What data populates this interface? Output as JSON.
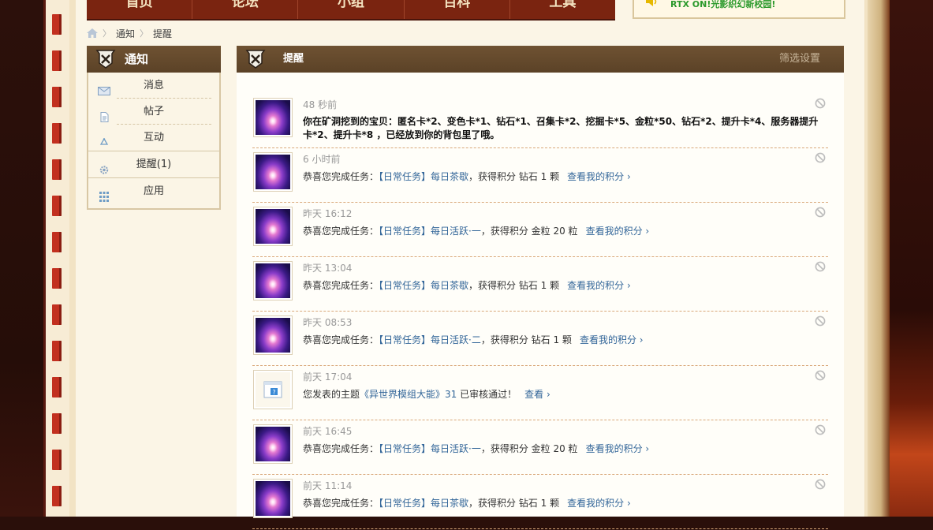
{
  "nav": {
    "items": [
      "首页",
      "论坛",
      "小组",
      "百科",
      "工具"
    ]
  },
  "announcement": {
    "text": "RTX ON!光影织幻新校园!",
    "icon": "speaker-icon"
  },
  "breadcrumb": {
    "home_icon": "home-icon",
    "items": [
      "通知",
      "提醒"
    ]
  },
  "sidebar": {
    "title": "通知",
    "items": [
      {
        "label": "消息",
        "icon": "mail-icon"
      },
      {
        "label": "帖子",
        "icon": "document-icon"
      },
      {
        "label": "互动",
        "icon": "recycle-icon"
      },
      {
        "label": "提醒(1)",
        "icon": "gear-icon"
      },
      {
        "label": "应用",
        "icon": "grid-icon"
      }
    ]
  },
  "main": {
    "title": "提醒",
    "filter_label": "筛选设置",
    "notices": [
      {
        "time": "48 秒前",
        "text": "你在矿洞挖到的宝贝：匿名卡*2、变色卡*1、钻石*1、召集卡*2、挖掘卡*5、金粒*50、钻石*2、提升卡*4、服务器提升卡*2、提升卡*8 ，已经放到你的背包里了哦。",
        "avatar": "galaxy"
      },
      {
        "time": "6 小时前",
        "prefix": "恭喜您完成任务：",
        "task": "【日常任务】每日茶歇",
        "reward": "，获得积分 钻石 1 颗",
        "link": "查看我的积分 ›",
        "avatar": "galaxy"
      },
      {
        "time": "昨天 16:12",
        "prefix": "恭喜您完成任务：",
        "task": "【日常任务】每日活跃·一",
        "reward": "，获得积分 金粒 20 粒",
        "link": "查看我的积分 ›",
        "avatar": "galaxy"
      },
      {
        "time": "昨天 13:04",
        "prefix": "恭喜您完成任务：",
        "task": "【日常任务】每日茶歇",
        "reward": "，获得积分 钻石 1 颗",
        "link": "查看我的积分 ›",
        "avatar": "galaxy"
      },
      {
        "time": "昨天 08:53",
        "prefix": "恭喜您完成任务：",
        "task": "【日常任务】每日活跃·二",
        "reward": "，获得积分 钻石 1 颗",
        "link": "查看我的积分 ›",
        "avatar": "galaxy"
      },
      {
        "time": "前天 17:04",
        "prefix": "您发表的主题",
        "task": "《异世界模组大能》31",
        "reward": " 已审核通过！",
        "link": "查看 ›",
        "avatar": "doc"
      },
      {
        "time": "前天 16:45",
        "prefix": "恭喜您完成任务：",
        "task": "【日常任务】每日活跃·一",
        "reward": "，获得积分 金粒 20 粒",
        "link": "查看我的积分 ›",
        "avatar": "galaxy"
      },
      {
        "time": "前天 11:14",
        "prefix": "恭喜您完成任务：",
        "task": "【日常任务】每日茶歇",
        "reward": "，获得积分 钻石 1 颗",
        "link": "查看我的积分 ›",
        "avatar": "galaxy"
      }
    ]
  },
  "colors": {
    "nav_bg": "#7a2410",
    "panel_head": "#6f5232",
    "link_blue": "#336699",
    "announce_green": "#2c9a2c"
  }
}
